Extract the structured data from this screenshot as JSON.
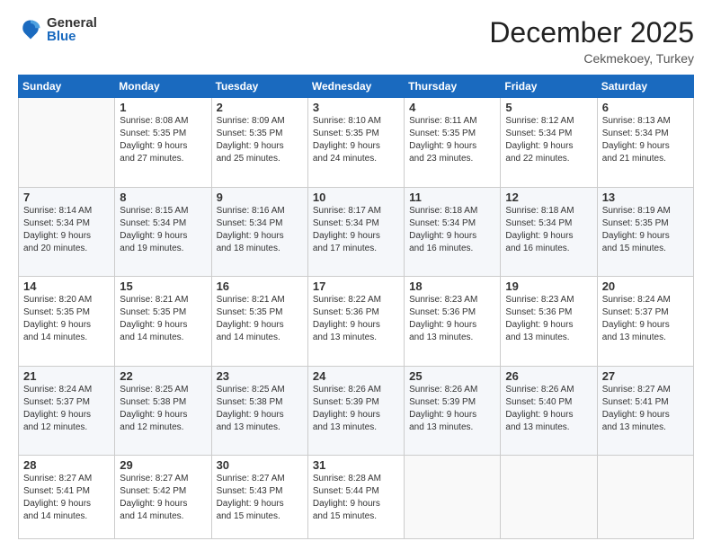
{
  "logo": {
    "general": "General",
    "blue": "Blue"
  },
  "header": {
    "title": "December 2025",
    "subtitle": "Cekmekoey, Turkey"
  },
  "weekdays": [
    "Sunday",
    "Monday",
    "Tuesday",
    "Wednesday",
    "Thursday",
    "Friday",
    "Saturday"
  ],
  "weeks": [
    [
      {
        "day": "",
        "info": ""
      },
      {
        "day": "1",
        "info": "Sunrise: 8:08 AM\nSunset: 5:35 PM\nDaylight: 9 hours\nand 27 minutes."
      },
      {
        "day": "2",
        "info": "Sunrise: 8:09 AM\nSunset: 5:35 PM\nDaylight: 9 hours\nand 25 minutes."
      },
      {
        "day": "3",
        "info": "Sunrise: 8:10 AM\nSunset: 5:35 PM\nDaylight: 9 hours\nand 24 minutes."
      },
      {
        "day": "4",
        "info": "Sunrise: 8:11 AM\nSunset: 5:35 PM\nDaylight: 9 hours\nand 23 minutes."
      },
      {
        "day": "5",
        "info": "Sunrise: 8:12 AM\nSunset: 5:34 PM\nDaylight: 9 hours\nand 22 minutes."
      },
      {
        "day": "6",
        "info": "Sunrise: 8:13 AM\nSunset: 5:34 PM\nDaylight: 9 hours\nand 21 minutes."
      }
    ],
    [
      {
        "day": "7",
        "info": "Sunrise: 8:14 AM\nSunset: 5:34 PM\nDaylight: 9 hours\nand 20 minutes."
      },
      {
        "day": "8",
        "info": "Sunrise: 8:15 AM\nSunset: 5:34 PM\nDaylight: 9 hours\nand 19 minutes."
      },
      {
        "day": "9",
        "info": "Sunrise: 8:16 AM\nSunset: 5:34 PM\nDaylight: 9 hours\nand 18 minutes."
      },
      {
        "day": "10",
        "info": "Sunrise: 8:17 AM\nSunset: 5:34 PM\nDaylight: 9 hours\nand 17 minutes."
      },
      {
        "day": "11",
        "info": "Sunrise: 8:18 AM\nSunset: 5:34 PM\nDaylight: 9 hours\nand 16 minutes."
      },
      {
        "day": "12",
        "info": "Sunrise: 8:18 AM\nSunset: 5:34 PM\nDaylight: 9 hours\nand 16 minutes."
      },
      {
        "day": "13",
        "info": "Sunrise: 8:19 AM\nSunset: 5:35 PM\nDaylight: 9 hours\nand 15 minutes."
      }
    ],
    [
      {
        "day": "14",
        "info": "Sunrise: 8:20 AM\nSunset: 5:35 PM\nDaylight: 9 hours\nand 14 minutes."
      },
      {
        "day": "15",
        "info": "Sunrise: 8:21 AM\nSunset: 5:35 PM\nDaylight: 9 hours\nand 14 minutes."
      },
      {
        "day": "16",
        "info": "Sunrise: 8:21 AM\nSunset: 5:35 PM\nDaylight: 9 hours\nand 14 minutes."
      },
      {
        "day": "17",
        "info": "Sunrise: 8:22 AM\nSunset: 5:36 PM\nDaylight: 9 hours\nand 13 minutes."
      },
      {
        "day": "18",
        "info": "Sunrise: 8:23 AM\nSunset: 5:36 PM\nDaylight: 9 hours\nand 13 minutes."
      },
      {
        "day": "19",
        "info": "Sunrise: 8:23 AM\nSunset: 5:36 PM\nDaylight: 9 hours\nand 13 minutes."
      },
      {
        "day": "20",
        "info": "Sunrise: 8:24 AM\nSunset: 5:37 PM\nDaylight: 9 hours\nand 13 minutes."
      }
    ],
    [
      {
        "day": "21",
        "info": "Sunrise: 8:24 AM\nSunset: 5:37 PM\nDaylight: 9 hours\nand 12 minutes."
      },
      {
        "day": "22",
        "info": "Sunrise: 8:25 AM\nSunset: 5:38 PM\nDaylight: 9 hours\nand 12 minutes."
      },
      {
        "day": "23",
        "info": "Sunrise: 8:25 AM\nSunset: 5:38 PM\nDaylight: 9 hours\nand 13 minutes."
      },
      {
        "day": "24",
        "info": "Sunrise: 8:26 AM\nSunset: 5:39 PM\nDaylight: 9 hours\nand 13 minutes."
      },
      {
        "day": "25",
        "info": "Sunrise: 8:26 AM\nSunset: 5:39 PM\nDaylight: 9 hours\nand 13 minutes."
      },
      {
        "day": "26",
        "info": "Sunrise: 8:26 AM\nSunset: 5:40 PM\nDaylight: 9 hours\nand 13 minutes."
      },
      {
        "day": "27",
        "info": "Sunrise: 8:27 AM\nSunset: 5:41 PM\nDaylight: 9 hours\nand 13 minutes."
      }
    ],
    [
      {
        "day": "28",
        "info": "Sunrise: 8:27 AM\nSunset: 5:41 PM\nDaylight: 9 hours\nand 14 minutes."
      },
      {
        "day": "29",
        "info": "Sunrise: 8:27 AM\nSunset: 5:42 PM\nDaylight: 9 hours\nand 14 minutes."
      },
      {
        "day": "30",
        "info": "Sunrise: 8:27 AM\nSunset: 5:43 PM\nDaylight: 9 hours\nand 15 minutes."
      },
      {
        "day": "31",
        "info": "Sunrise: 8:28 AM\nSunset: 5:44 PM\nDaylight: 9 hours\nand 15 minutes."
      },
      {
        "day": "",
        "info": ""
      },
      {
        "day": "",
        "info": ""
      },
      {
        "day": "",
        "info": ""
      }
    ]
  ]
}
